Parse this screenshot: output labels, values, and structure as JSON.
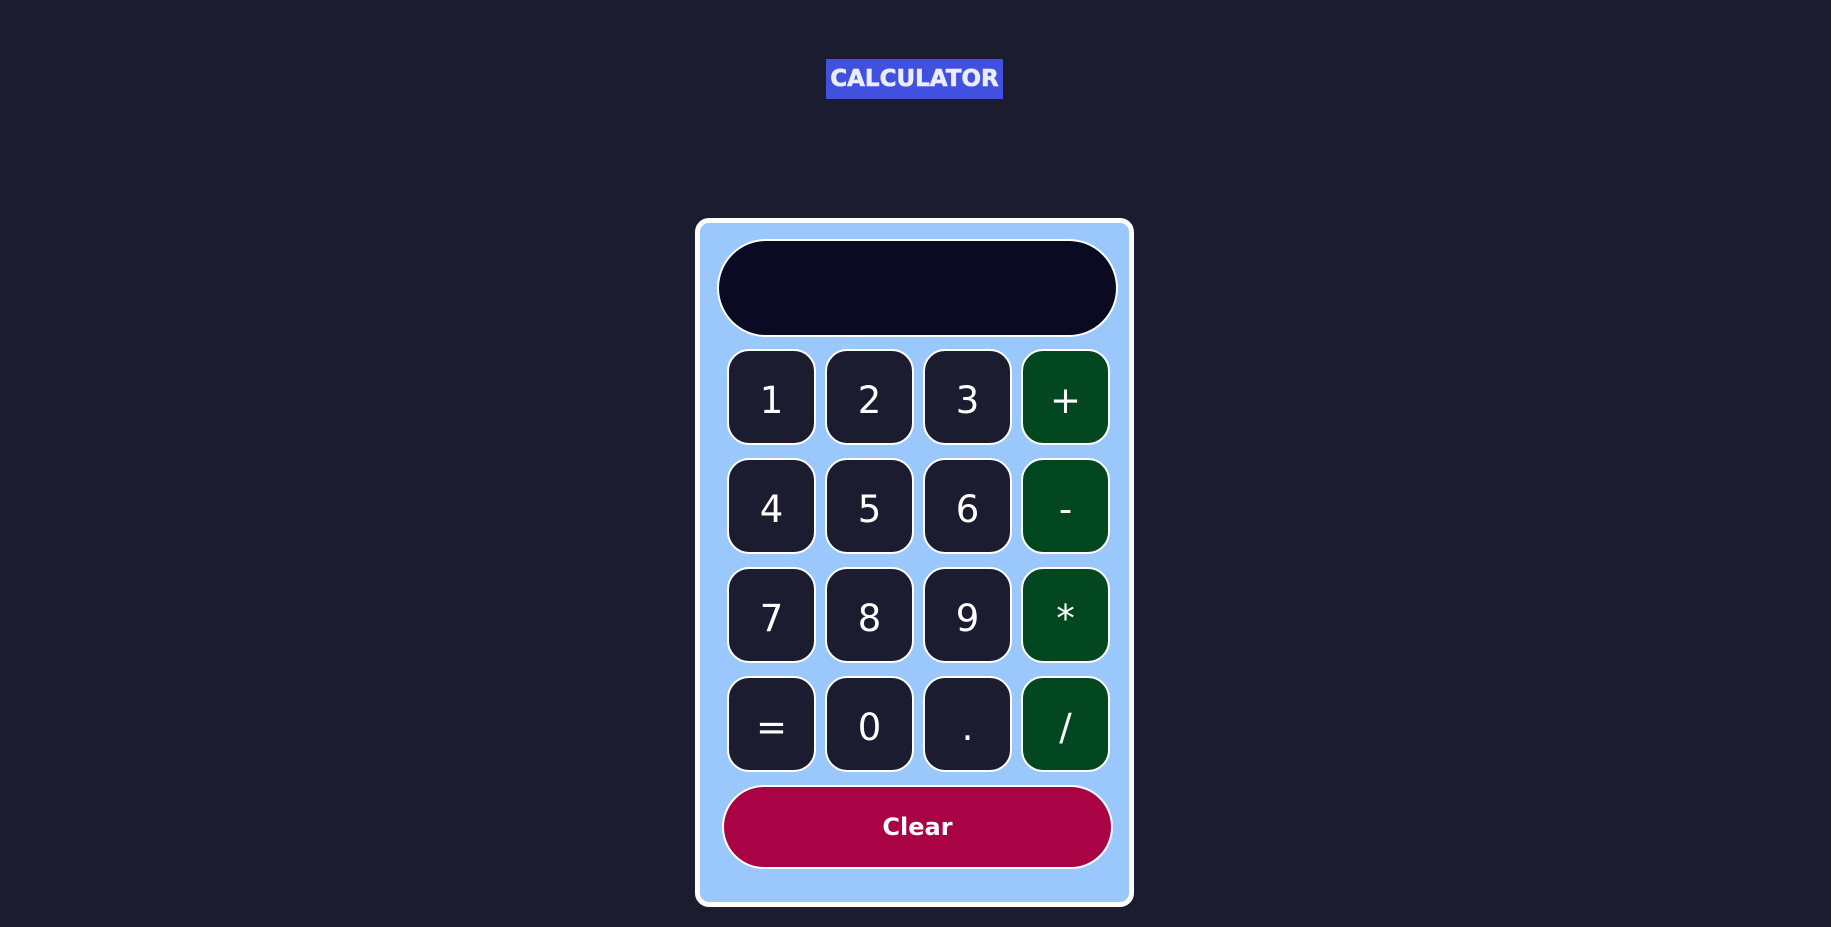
{
  "header": {
    "title": "CALCULATOR"
  },
  "display": {
    "value": ""
  },
  "keypad": {
    "keys": [
      {
        "label": "1",
        "type": "digit"
      },
      {
        "label": "2",
        "type": "digit"
      },
      {
        "label": "3",
        "type": "digit"
      },
      {
        "label": "+",
        "type": "operator"
      },
      {
        "label": "4",
        "type": "digit"
      },
      {
        "label": "5",
        "type": "digit"
      },
      {
        "label": "6",
        "type": "digit"
      },
      {
        "label": "-",
        "type": "operator"
      },
      {
        "label": "7",
        "type": "digit"
      },
      {
        "label": "8",
        "type": "digit"
      },
      {
        "label": "9",
        "type": "digit"
      },
      {
        "label": "*",
        "type": "operator"
      },
      {
        "label": "=",
        "type": "equals"
      },
      {
        "label": "0",
        "type": "digit"
      },
      {
        "label": ".",
        "type": "decimal"
      },
      {
        "label": "/",
        "type": "operator"
      }
    ]
  },
  "clear": {
    "label": "Clear"
  },
  "colors": {
    "page_background": "#1c1c31",
    "title_background": "#4051e0",
    "calculator_body": "#9bc8fc",
    "display_background": "#0a0b22",
    "number_key": "#1c1c31",
    "operator_key": "#034720",
    "clear_button": "#a90345"
  }
}
